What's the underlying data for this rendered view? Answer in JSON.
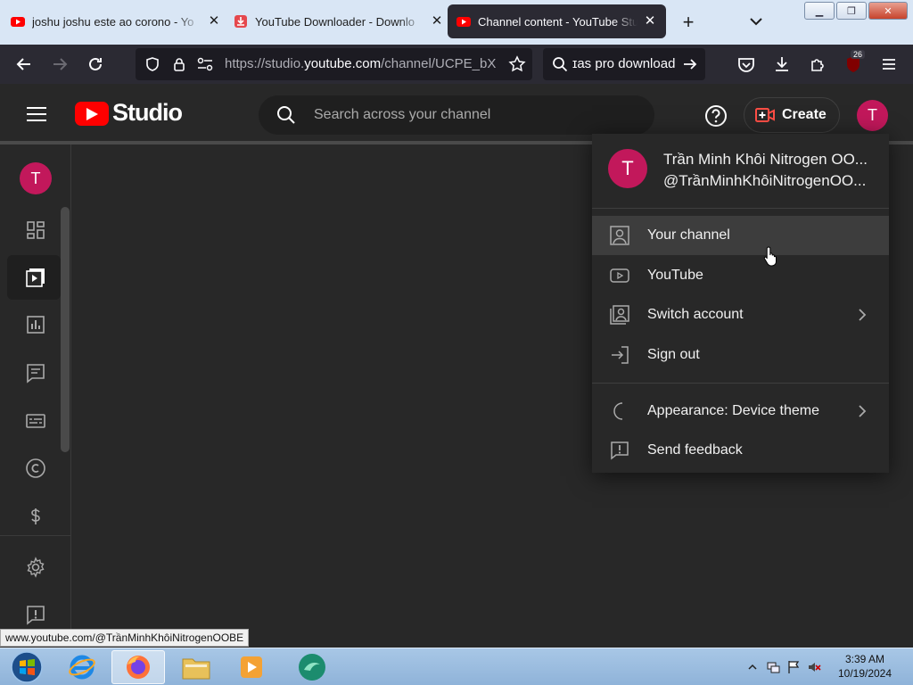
{
  "browser": {
    "tabs": [
      {
        "title": "joshu joshu este ao corono - Yo",
        "favicon": "youtube-icon"
      },
      {
        "title": "YouTube Downloader - Downlo",
        "favicon": "downloader-icon"
      },
      {
        "title": "Channel content - YouTube Stud",
        "favicon": "youtube-icon",
        "active": true
      }
    ],
    "url_prefix": "https://studio.",
    "url_domain": "youtube.com",
    "url_rest": "/channel/UCPE_bXi",
    "search_text": "ɪas pro download",
    "extension_badge": "26"
  },
  "studio": {
    "logo_text": "Studio",
    "search_placeholder": "Search across your channel",
    "create_label": "Create",
    "avatar_letter": "T"
  },
  "account_menu": {
    "name": "Trần Minh Khôi Nitrogen OO...",
    "handle": "@TrầnMinhKhôiNitrogenOO...",
    "items": [
      {
        "label": "Your channel",
        "icon": "account-box-icon"
      },
      {
        "label": "YouTube",
        "icon": "youtube-play-icon"
      },
      {
        "label": "Switch account",
        "icon": "switch-account-icon"
      },
      {
        "label": "Sign out",
        "icon": "sign-out-icon"
      }
    ],
    "items2": [
      {
        "label": "Appearance: Device theme",
        "icon": "moon-icon"
      },
      {
        "label": "Send feedback",
        "icon": "feedback-icon"
      }
    ]
  },
  "status_url": "www.youtube.com/@TrầnMinhKhôiNitrogenOOBE",
  "taskbar": {
    "time": "3:39 AM",
    "date": "10/19/2024"
  },
  "colors": {
    "youtube_red": "#ff0000",
    "avatar": "#c2185b",
    "bg": "#282828"
  }
}
